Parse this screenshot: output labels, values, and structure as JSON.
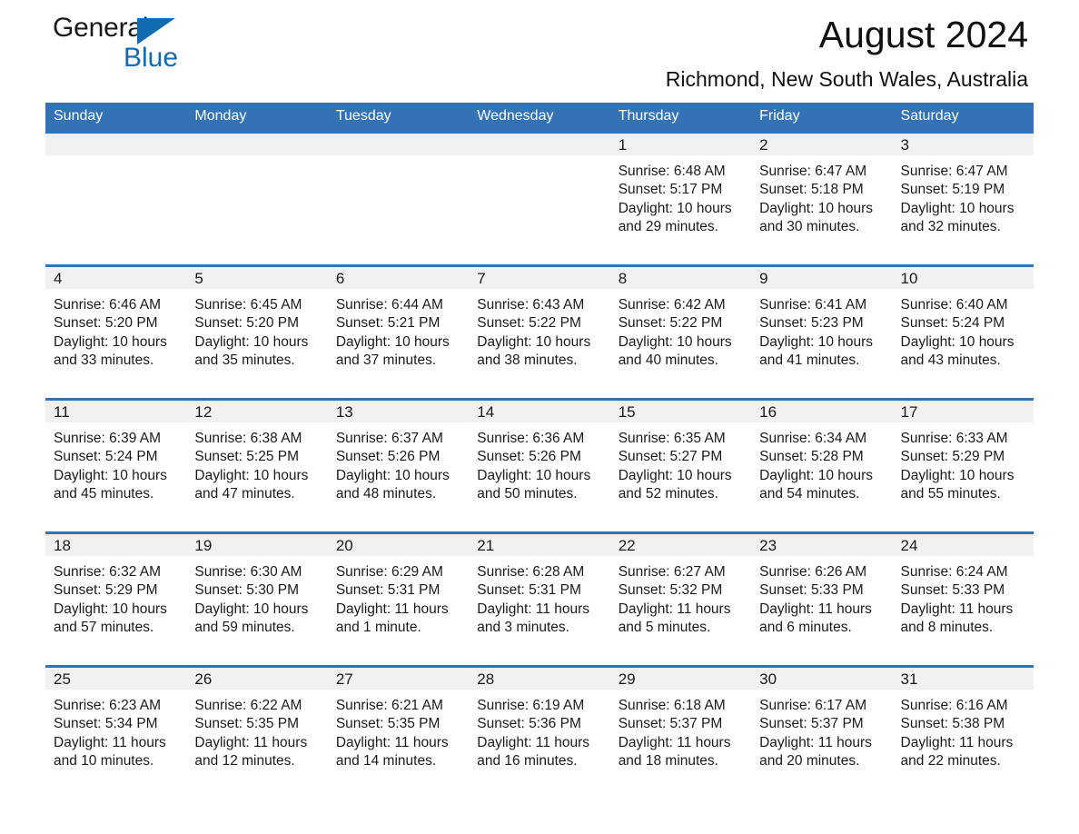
{
  "brand": {
    "logo_text_1": "General",
    "logo_text_2": "Blue",
    "accent_color": "#106bb0",
    "header_color": "#3373b5",
    "band_color": "#f1f1f1"
  },
  "header": {
    "title": "August 2024",
    "location": "Richmond, New South Wales, Australia"
  },
  "weekday_headers": [
    "Sunday",
    "Monday",
    "Tuesday",
    "Wednesday",
    "Thursday",
    "Friday",
    "Saturday"
  ],
  "weeks": [
    [
      {
        "day": "",
        "sunrise": "",
        "sunset": "",
        "daylight_1": "",
        "daylight_2": ""
      },
      {
        "day": "",
        "sunrise": "",
        "sunset": "",
        "daylight_1": "",
        "daylight_2": ""
      },
      {
        "day": "",
        "sunrise": "",
        "sunset": "",
        "daylight_1": "",
        "daylight_2": ""
      },
      {
        "day": "",
        "sunrise": "",
        "sunset": "",
        "daylight_1": "",
        "daylight_2": ""
      },
      {
        "day": "1",
        "sunrise": "Sunrise: 6:48 AM",
        "sunset": "Sunset: 5:17 PM",
        "daylight_1": "Daylight: 10 hours",
        "daylight_2": "and 29 minutes."
      },
      {
        "day": "2",
        "sunrise": "Sunrise: 6:47 AM",
        "sunset": "Sunset: 5:18 PM",
        "daylight_1": "Daylight: 10 hours",
        "daylight_2": "and 30 minutes."
      },
      {
        "day": "3",
        "sunrise": "Sunrise: 6:47 AM",
        "sunset": "Sunset: 5:19 PM",
        "daylight_1": "Daylight: 10 hours",
        "daylight_2": "and 32 minutes."
      }
    ],
    [
      {
        "day": "4",
        "sunrise": "Sunrise: 6:46 AM",
        "sunset": "Sunset: 5:20 PM",
        "daylight_1": "Daylight: 10 hours",
        "daylight_2": "and 33 minutes."
      },
      {
        "day": "5",
        "sunrise": "Sunrise: 6:45 AM",
        "sunset": "Sunset: 5:20 PM",
        "daylight_1": "Daylight: 10 hours",
        "daylight_2": "and 35 minutes."
      },
      {
        "day": "6",
        "sunrise": "Sunrise: 6:44 AM",
        "sunset": "Sunset: 5:21 PM",
        "daylight_1": "Daylight: 10 hours",
        "daylight_2": "and 37 minutes."
      },
      {
        "day": "7",
        "sunrise": "Sunrise: 6:43 AM",
        "sunset": "Sunset: 5:22 PM",
        "daylight_1": "Daylight: 10 hours",
        "daylight_2": "and 38 minutes."
      },
      {
        "day": "8",
        "sunrise": "Sunrise: 6:42 AM",
        "sunset": "Sunset: 5:22 PM",
        "daylight_1": "Daylight: 10 hours",
        "daylight_2": "and 40 minutes."
      },
      {
        "day": "9",
        "sunrise": "Sunrise: 6:41 AM",
        "sunset": "Sunset: 5:23 PM",
        "daylight_1": "Daylight: 10 hours",
        "daylight_2": "and 41 minutes."
      },
      {
        "day": "10",
        "sunrise": "Sunrise: 6:40 AM",
        "sunset": "Sunset: 5:24 PM",
        "daylight_1": "Daylight: 10 hours",
        "daylight_2": "and 43 minutes."
      }
    ],
    [
      {
        "day": "11",
        "sunrise": "Sunrise: 6:39 AM",
        "sunset": "Sunset: 5:24 PM",
        "daylight_1": "Daylight: 10 hours",
        "daylight_2": "and 45 minutes."
      },
      {
        "day": "12",
        "sunrise": "Sunrise: 6:38 AM",
        "sunset": "Sunset: 5:25 PM",
        "daylight_1": "Daylight: 10 hours",
        "daylight_2": "and 47 minutes."
      },
      {
        "day": "13",
        "sunrise": "Sunrise: 6:37 AM",
        "sunset": "Sunset: 5:26 PM",
        "daylight_1": "Daylight: 10 hours",
        "daylight_2": "and 48 minutes."
      },
      {
        "day": "14",
        "sunrise": "Sunrise: 6:36 AM",
        "sunset": "Sunset: 5:26 PM",
        "daylight_1": "Daylight: 10 hours",
        "daylight_2": "and 50 minutes."
      },
      {
        "day": "15",
        "sunrise": "Sunrise: 6:35 AM",
        "sunset": "Sunset: 5:27 PM",
        "daylight_1": "Daylight: 10 hours",
        "daylight_2": "and 52 minutes."
      },
      {
        "day": "16",
        "sunrise": "Sunrise: 6:34 AM",
        "sunset": "Sunset: 5:28 PM",
        "daylight_1": "Daylight: 10 hours",
        "daylight_2": "and 54 minutes."
      },
      {
        "day": "17",
        "sunrise": "Sunrise: 6:33 AM",
        "sunset": "Sunset: 5:29 PM",
        "daylight_1": "Daylight: 10 hours",
        "daylight_2": "and 55 minutes."
      }
    ],
    [
      {
        "day": "18",
        "sunrise": "Sunrise: 6:32 AM",
        "sunset": "Sunset: 5:29 PM",
        "daylight_1": "Daylight: 10 hours",
        "daylight_2": "and 57 minutes."
      },
      {
        "day": "19",
        "sunrise": "Sunrise: 6:30 AM",
        "sunset": "Sunset: 5:30 PM",
        "daylight_1": "Daylight: 10 hours",
        "daylight_2": "and 59 minutes."
      },
      {
        "day": "20",
        "sunrise": "Sunrise: 6:29 AM",
        "sunset": "Sunset: 5:31 PM",
        "daylight_1": "Daylight: 11 hours",
        "daylight_2": "and 1 minute."
      },
      {
        "day": "21",
        "sunrise": "Sunrise: 6:28 AM",
        "sunset": "Sunset: 5:31 PM",
        "daylight_1": "Daylight: 11 hours",
        "daylight_2": "and 3 minutes."
      },
      {
        "day": "22",
        "sunrise": "Sunrise: 6:27 AM",
        "sunset": "Sunset: 5:32 PM",
        "daylight_1": "Daylight: 11 hours",
        "daylight_2": "and 5 minutes."
      },
      {
        "day": "23",
        "sunrise": "Sunrise: 6:26 AM",
        "sunset": "Sunset: 5:33 PM",
        "daylight_1": "Daylight: 11 hours",
        "daylight_2": "and 6 minutes."
      },
      {
        "day": "24",
        "sunrise": "Sunrise: 6:24 AM",
        "sunset": "Sunset: 5:33 PM",
        "daylight_1": "Daylight: 11 hours",
        "daylight_2": "and 8 minutes."
      }
    ],
    [
      {
        "day": "25",
        "sunrise": "Sunrise: 6:23 AM",
        "sunset": "Sunset: 5:34 PM",
        "daylight_1": "Daylight: 11 hours",
        "daylight_2": "and 10 minutes."
      },
      {
        "day": "26",
        "sunrise": "Sunrise: 6:22 AM",
        "sunset": "Sunset: 5:35 PM",
        "daylight_1": "Daylight: 11 hours",
        "daylight_2": "and 12 minutes."
      },
      {
        "day": "27",
        "sunrise": "Sunrise: 6:21 AM",
        "sunset": "Sunset: 5:35 PM",
        "daylight_1": "Daylight: 11 hours",
        "daylight_2": "and 14 minutes."
      },
      {
        "day": "28",
        "sunrise": "Sunrise: 6:19 AM",
        "sunset": "Sunset: 5:36 PM",
        "daylight_1": "Daylight: 11 hours",
        "daylight_2": "and 16 minutes."
      },
      {
        "day": "29",
        "sunrise": "Sunrise: 6:18 AM",
        "sunset": "Sunset: 5:37 PM",
        "daylight_1": "Daylight: 11 hours",
        "daylight_2": "and 18 minutes."
      },
      {
        "day": "30",
        "sunrise": "Sunrise: 6:17 AM",
        "sunset": "Sunset: 5:37 PM",
        "daylight_1": "Daylight: 11 hours",
        "daylight_2": "and 20 minutes."
      },
      {
        "day": "31",
        "sunrise": "Sunrise: 6:16 AM",
        "sunset": "Sunset: 5:38 PM",
        "daylight_1": "Daylight: 11 hours",
        "daylight_2": "and 22 minutes."
      }
    ]
  ]
}
